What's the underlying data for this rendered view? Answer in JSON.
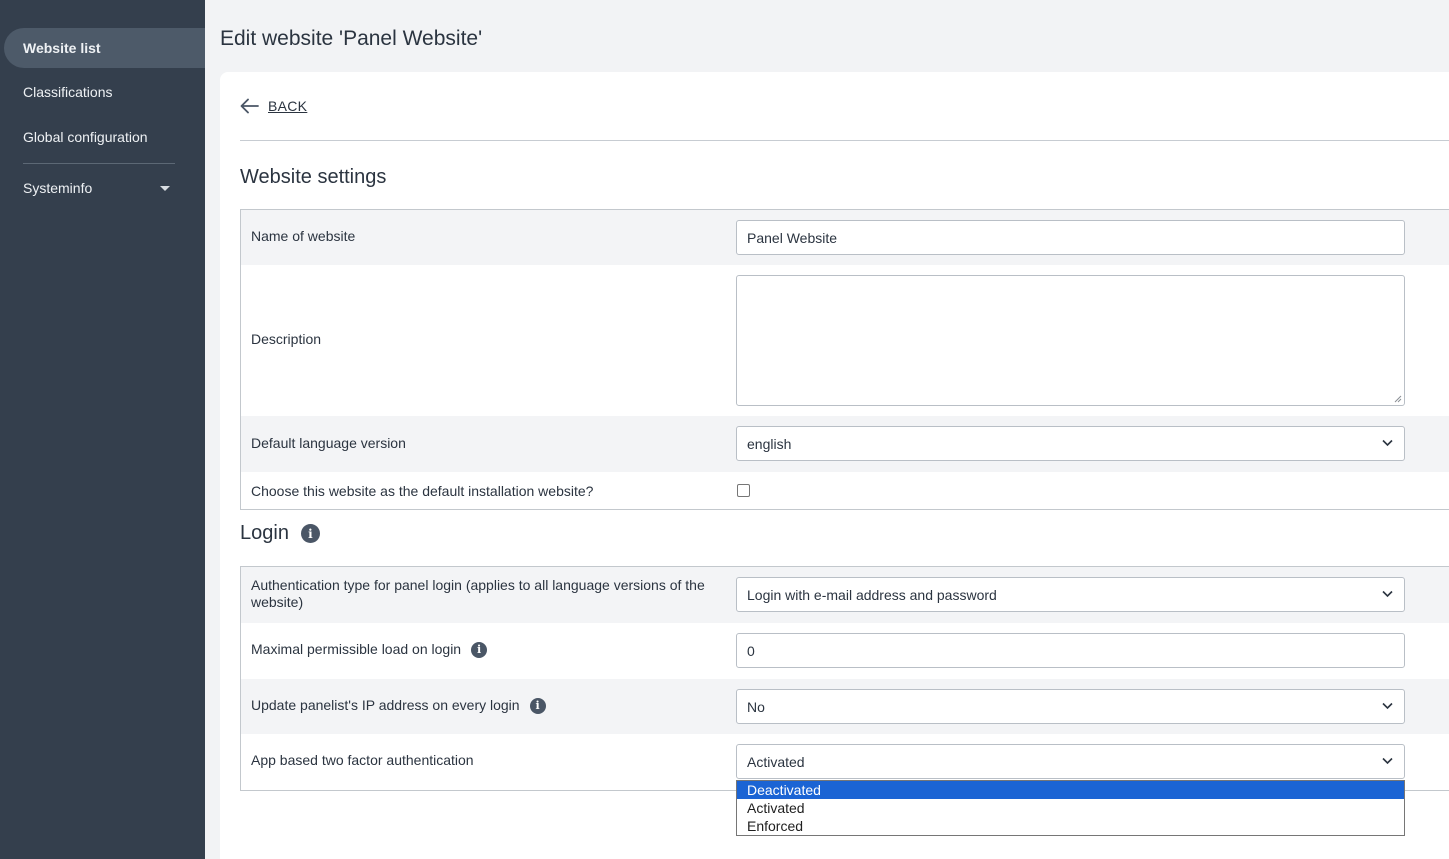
{
  "sidebar": {
    "items": [
      {
        "label": "Website list"
      },
      {
        "label": "Classifications"
      },
      {
        "label": "Global configuration"
      },
      {
        "label": "Systeminfo"
      }
    ]
  },
  "page": {
    "title": "Edit website 'Panel Website'",
    "back_label": "BACK"
  },
  "website_settings": {
    "title": "Website settings",
    "name_label": "Name of website",
    "name_value": "Panel Website",
    "description_label": "Description",
    "description_value": "",
    "language_label": "Default language version",
    "language_value": "english",
    "default_install_label": "Choose this website as the default installation website?",
    "default_install_checked": false
  },
  "login": {
    "title": "Login",
    "auth_type_label": "Authentication type for panel login (applies to all language versions of the website)",
    "auth_type_value": "Login with e-mail address and password",
    "max_load_label": "Maximal permissible load on login",
    "max_load_value": "0",
    "update_ip_label": "Update panelist's IP address on every login",
    "update_ip_value": "No",
    "two_factor_label": "App based two factor authentication",
    "two_factor_value": "Activated",
    "two_factor_options": [
      "Deactivated",
      "Activated",
      "Enforced"
    ],
    "two_factor_highlighted": "Deactivated"
  },
  "colors": {
    "sidebar_bg": "#343f4d",
    "sidebar_active_bg": "#4d5a69",
    "dropdown_highlight": "#1b64d4"
  }
}
